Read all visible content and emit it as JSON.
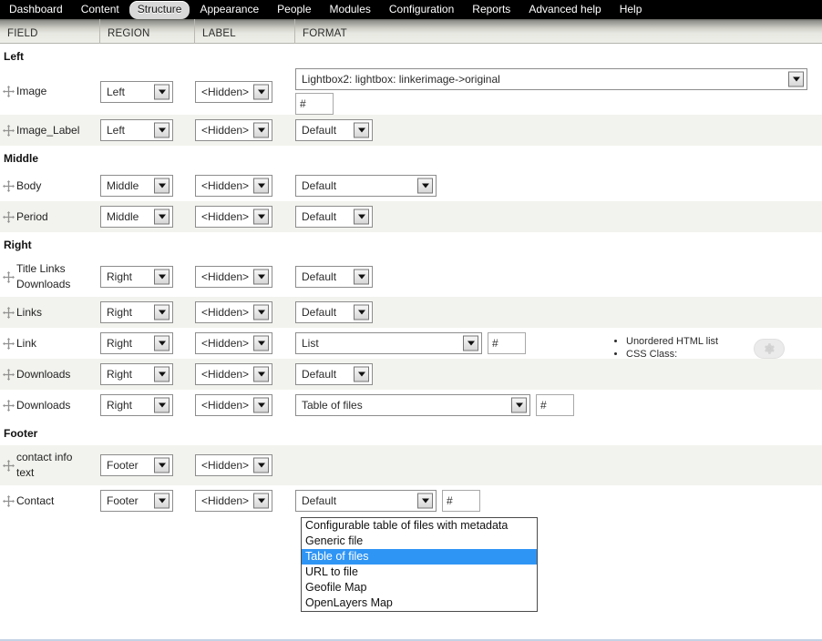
{
  "toolbar": {
    "items": [
      {
        "label": "Dashboard",
        "active": false
      },
      {
        "label": "Content",
        "active": false
      },
      {
        "label": "Structure",
        "active": true
      },
      {
        "label": "Appearance",
        "active": false
      },
      {
        "label": "People",
        "active": false
      },
      {
        "label": "Modules",
        "active": false
      },
      {
        "label": "Configuration",
        "active": false
      },
      {
        "label": "Reports",
        "active": false
      },
      {
        "label": "Advanced help",
        "active": false
      },
      {
        "label": "Help",
        "active": false
      }
    ]
  },
  "table": {
    "headers": {
      "field": "FIELD",
      "region": "REGION",
      "label": "LABEL",
      "format": "FORMAT"
    },
    "regions": [
      {
        "name": "Left",
        "rows": [
          {
            "field": "Image",
            "region_value": "Left",
            "label_value": "<Hidden>",
            "format_value": "Lightbox2: lightbox: linkerimage->original",
            "format_width": "wide",
            "hash_value": "#",
            "hash_below": true,
            "summary": null
          },
          {
            "field": "Image_Label",
            "region_value": "Left",
            "label_value": "<Hidden>",
            "format_value": "Default",
            "format_width": "small",
            "hash_value": null,
            "hash_below": false,
            "summary": null
          }
        ]
      },
      {
        "name": "Middle",
        "rows": [
          {
            "field": "Body",
            "region_value": "Middle",
            "label_value": "<Hidden>",
            "format_value": "Default",
            "format_width": "body",
            "hash_value": null,
            "hash_below": false,
            "summary": null
          },
          {
            "field": "Period",
            "region_value": "Middle",
            "label_value": "<Hidden>",
            "format_value": "Default",
            "format_width": "small",
            "hash_value": null,
            "hash_below": false,
            "summary": null
          }
        ]
      },
      {
        "name": "Right",
        "rows": [
          {
            "field": "Title Links Downloads",
            "region_value": "Right",
            "label_value": "<Hidden>",
            "format_value": "Default",
            "format_width": "small",
            "hash_value": null,
            "hash_below": false,
            "summary": null
          },
          {
            "field": "Links",
            "region_value": "Right",
            "label_value": "<Hidden>",
            "format_value": "Default",
            "format_width": "small",
            "hash_value": null,
            "hash_below": false,
            "summary": null
          },
          {
            "field": "Link",
            "region_value": "Right",
            "label_value": "<Hidden>",
            "format_value": "List",
            "format_width": "list",
            "hash_value": "#",
            "hash_below": false,
            "summary": {
              "line1": "Unordered HTML list",
              "line2": "CSS Class:",
              "css_class": "textformatter-list",
              "gear_icon": "gear-icon"
            }
          },
          {
            "field": "Downloads",
            "region_value": "Right",
            "label_value": "<Hidden>",
            "format_value": "Default",
            "format_width": "small",
            "hash_value": null,
            "hash_below": false,
            "summary": null
          },
          {
            "field": "Downloads",
            "region_value": "Right",
            "label_value": "<Hidden>",
            "format_value": "Table of files",
            "format_width": "tof",
            "hash_value": "#",
            "hash_below": false,
            "summary": null
          }
        ]
      },
      {
        "name": "Footer",
        "rows": [
          {
            "field": "contact info text",
            "region_value": "Footer",
            "label_value": "<Hidden>",
            "format_value": "",
            "format_width": "none",
            "hash_value": null,
            "hash_below": false,
            "summary": null
          },
          {
            "field": "Contact",
            "region_value": "Footer",
            "label_value": "<Hidden>",
            "format_value": "Default",
            "format_width": "body",
            "hash_value": "#",
            "hash_below": false,
            "summary": null
          }
        ]
      }
    ]
  },
  "open_dropdown": {
    "options": [
      {
        "label": "Configurable table of files with metadata",
        "selected": false
      },
      {
        "label": "Generic file",
        "selected": false
      },
      {
        "label": "Table of files",
        "selected": true
      },
      {
        "label": "URL to file",
        "selected": false
      },
      {
        "label": "Geofile Map",
        "selected": false
      },
      {
        "label": "OpenLayers Map",
        "selected": false
      }
    ]
  },
  "colors": {
    "toolbar_bg": "#000000",
    "row_alt_bg": "#f2f3ee",
    "selected_option_bg": "#2f95f5",
    "header_gradient_top": "#5d5d5a"
  }
}
